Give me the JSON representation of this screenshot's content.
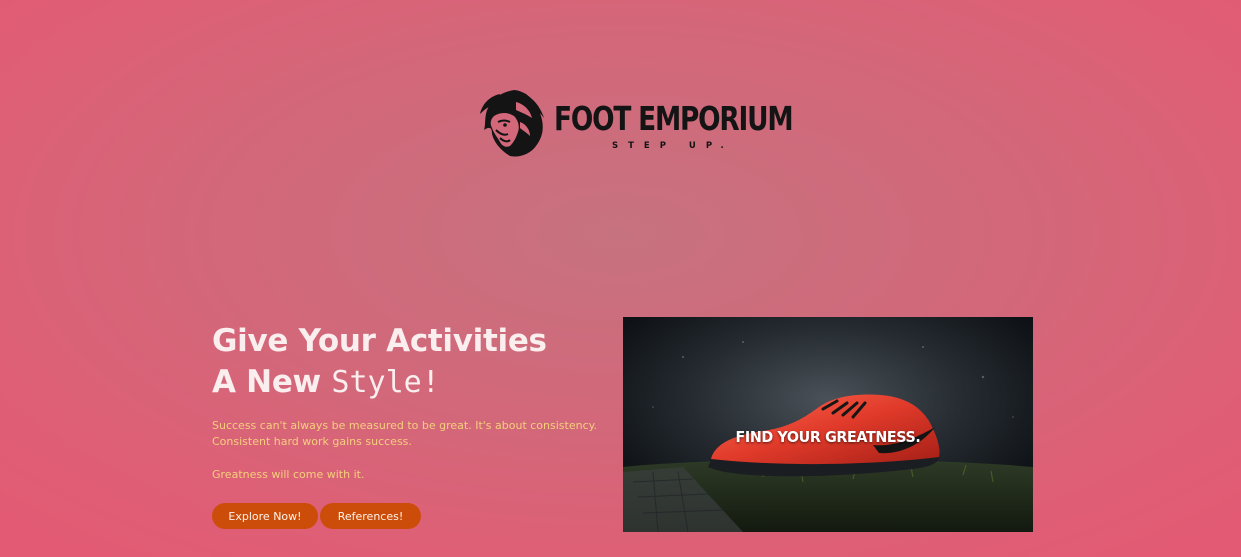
{
  "brand": {
    "name": "FOOT EMPORIUM",
    "tagline": "STEP UP.",
    "logo_icon": "lion-head-icon"
  },
  "hero": {
    "title_line1": "Give Your Activities",
    "title_line2_prefix": "A New",
    "title_line2_style": "Style!",
    "description": "Success can't always be measured to be great. It's about consistency. Consistent hard work gains success.",
    "description_2": "Greatness will come with it.",
    "buttons": {
      "explore": "Explore Now!",
      "references": "References!"
    },
    "image": {
      "caption": "FIND YOUR GREATNESS.",
      "subject": "red-sneaker-on-grass"
    }
  },
  "colors": {
    "background": "#dd6076",
    "title_text": "#fbeeee",
    "description_text": "#f5cf7c",
    "button_bg": "#cc4d0a",
    "button_text": "#fff3ea",
    "logo": "#141414"
  }
}
